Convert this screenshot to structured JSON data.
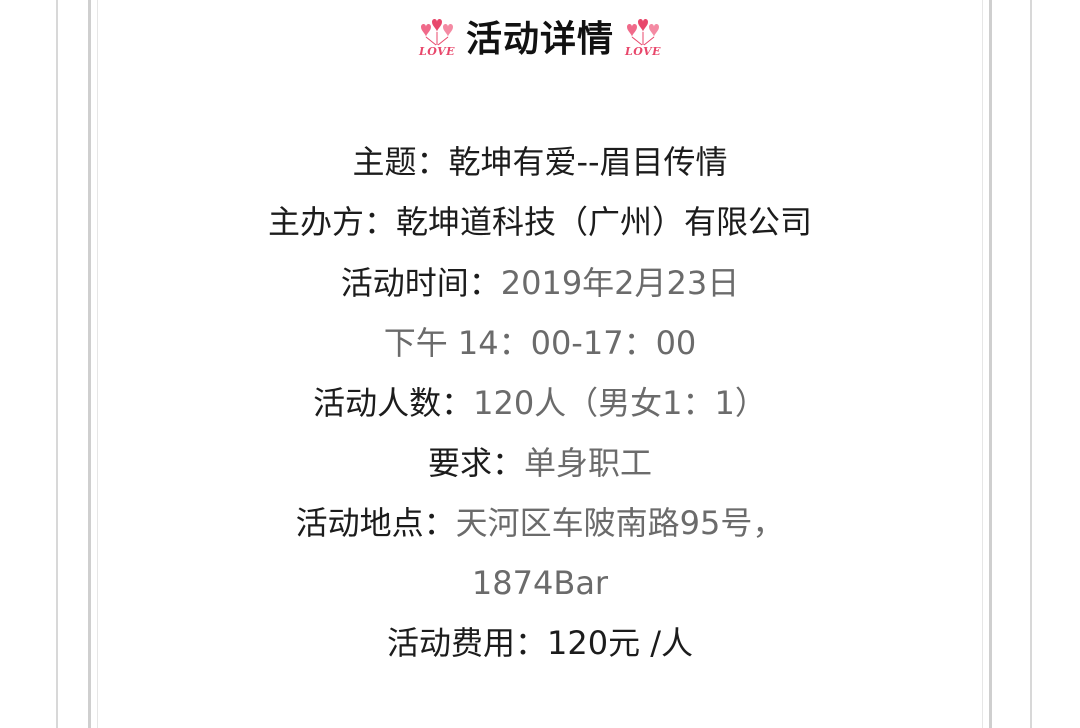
{
  "heading": {
    "title": "活动详情",
    "badge_word": "LOVE",
    "badge_icon": "heart-balloons-icon",
    "badge_color": "#e8476b"
  },
  "details": {
    "theme_label": "主题：",
    "theme_value": "乾坤有爱--眉目传情",
    "host_label": "主办方：",
    "host_value": "乾坤道科技（广州）有限公司",
    "time_label": "活动时间：",
    "time_date": "2019年2月23日",
    "time_range": "下午 14：00-17：00",
    "count_label": "活动人数：",
    "count_value": "120人（男女1：1）",
    "req_label": "要求：",
    "req_value": "单身职工",
    "place_label": "活动地点：",
    "place_value_1": "天河区车陂南路95号，",
    "place_value_2": "1874Bar",
    "fee_label": "活动费用：",
    "fee_value": "120元 /人"
  }
}
